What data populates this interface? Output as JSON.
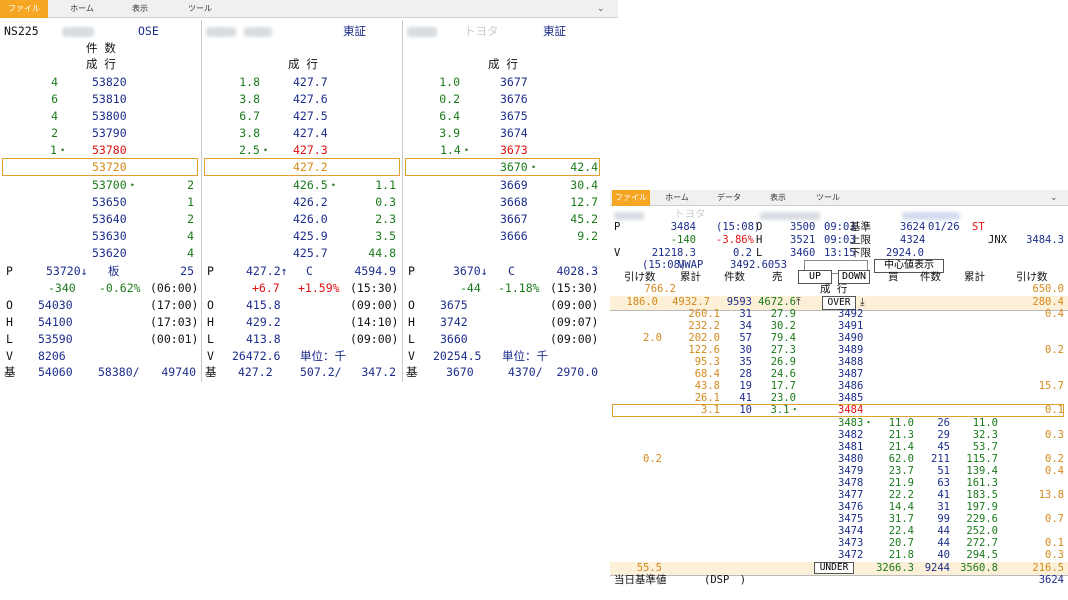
{
  "left_window": {
    "menu": [
      "ファイル",
      "ホーム",
      "表示",
      "ツール"
    ],
    "panel1": {
      "symbol": "NS225",
      "exchange": "OSE",
      "header1": "件 数",
      "header2": "成 行",
      "ask_rows": [
        {
          "qty": "4",
          "price": "53820"
        },
        {
          "qty": "6",
          "price": "53810"
        },
        {
          "qty": "4",
          "price": "53800"
        },
        {
          "qty": "2",
          "price": "53790"
        },
        {
          "qty": "1・",
          "price": "53780"
        }
      ],
      "current": {
        "price": "53720"
      },
      "bid_rows": [
        {
          "price": "53700・",
          "qty": "2"
        },
        {
          "price": "53650",
          "qty": "1"
        },
        {
          "price": "53640",
          "qty": "2"
        },
        {
          "price": "53630",
          "qty": "4"
        },
        {
          "price": "53620",
          "qty": "4"
        }
      ],
      "stats": {
        "p_label": "P",
        "p_value": "53720↓",
        "ita_label": "板",
        "ita_value": "25",
        "change": "-340",
        "change_pct": "-0.62%",
        "change_time": "(06:00)",
        "o_label": "O",
        "o_value": "54030",
        "o_time": "(17:00)",
        "h_label": "H",
        "h_value": "54100",
        "h_time": "(17:03)",
        "l_label": "L",
        "l_value": "53590",
        "l_time": "(00:01)",
        "v_label": "V",
        "v_value": "8206",
        "ki_label": "基",
        "ki_value": "54060",
        "ki_mid": "58380/",
        "ki_right": "49740"
      }
    },
    "panel2": {
      "exchange": "東証",
      "header2": "成 行",
      "ask_rows": [
        {
          "qty": "1.8",
          "price": "427.7"
        },
        {
          "qty": "3.8",
          "price": "427.6"
        },
        {
          "qty": "6.7",
          "price": "427.5"
        },
        {
          "qty": "3.8",
          "price": "427.4"
        },
        {
          "qty": "2.5・",
          "price": "427.3"
        }
      ],
      "current": {
        "price": "427.2"
      },
      "bid_rows": [
        {
          "price": "426.5・",
          "qty": "1.1"
        },
        {
          "price": "426.2",
          "qty": "0.3"
        },
        {
          "price": "426.0",
          "qty": "2.3"
        },
        {
          "price": "425.9",
          "qty": "3.5"
        },
        {
          "price": "425.7",
          "qty": "44.8"
        }
      ],
      "stats": {
        "p_label": "P",
        "p_value": "427.2↑",
        "c_label": "C",
        "c_value": "4594.9",
        "change": "+6.7",
        "change_pct": "+1.59%",
        "change_time": "(15:30)",
        "o_label": "O",
        "o_value": "415.8",
        "o_time": "(09:00)",
        "h_label": "H",
        "h_value": "429.2",
        "h_time": "(14:10)",
        "l_label": "L",
        "l_value": "413.8",
        "l_time": "(09:00)",
        "v_label": "V",
        "v_value": "26472.6",
        "unit": "単位：千",
        "ki_label": "基",
        "ki_value": "427.2",
        "ki_mid": "507.2/",
        "ki_right": "347.2"
      }
    },
    "panel3": {
      "name": "トヨタ",
      "exchange": "東証",
      "header2": "成 行",
      "ask_rows": [
        {
          "qty": "1.0",
          "price": "3677"
        },
        {
          "qty": "0.2",
          "price": "3676"
        },
        {
          "qty": "6.4",
          "price": "3675"
        },
        {
          "qty": "3.9",
          "price": "3674"
        },
        {
          "qty": "1.4・",
          "price": "3673"
        }
      ],
      "bid_rows": [
        {
          "price": "3670・",
          "qty": "42.4"
        },
        {
          "price": "3669",
          "qty": "30.4"
        },
        {
          "price": "3668",
          "qty": "12.7"
        },
        {
          "price": "3667",
          "qty": "45.2"
        },
        {
          "price": "3666",
          "qty": "9.2"
        }
      ],
      "stats": {
        "p_label": "P",
        "p_value": "3670↓",
        "c_label": "C",
        "c_value": "4028.3",
        "change": "-44",
        "change_pct": "-1.18%",
        "change_time": "(15:30)",
        "o_label": "O",
        "o_value": "3675",
        "o_time": "(09:00)",
        "h_label": "H",
        "h_value": "3742",
        "h_time": "(09:07)",
        "l_label": "L",
        "l_value": "3660",
        "l_time": "(09:00)",
        "v_label": "V",
        "v_value": "20254.5",
        "unit": "単位：千",
        "ki_label": "基",
        "ki_value": "3670",
        "ki_mid": "4370/",
        "ki_right": "2970.0"
      }
    }
  },
  "right_window": {
    "menu": [
      "ファイル",
      "ホーム",
      "データ",
      "表示",
      "ツール"
    ],
    "name": "トヨタ",
    "header": {
      "p_label": "P",
      "p_value": "3484",
      "p_time": "(15:08)",
      "o_label": "O",
      "o_value": "3500",
      "o_time": "09:03",
      "kijun_label": "基準",
      "kijun_value": "3624",
      "kijun_date": "01/26",
      "st": "ST",
      "change": "-140",
      "change_pct": "-3.86%",
      "h_label": "H",
      "h_value": "3521",
      "h_time": "09:03",
      "upper_label": "上限",
      "upper_value": "4324",
      "jnx_label": "JNX",
      "jnx_value": "3484.3",
      "v_label": "V",
      "v_value": "21218.3",
      "l_num": "0.2",
      "l_label": "L",
      "l_value": "3460",
      "l_time": "13:15",
      "lower_label": "下限",
      "lower_value": "2924.0",
      "vwap_time": "(15:08)",
      "vwap_label": "VWAP",
      "vwap_value": "3492.6053",
      "center_btn": "中心値表示"
    },
    "columns": {
      "hikesu_left": "引け数",
      "ruikei_left": "累計",
      "kensu_left": "件数",
      "uri": "売",
      "up_btn": "UP",
      "down_btn": "DOWN",
      "kai": "買",
      "kensu_right": "件数",
      "ruikei_right": "累計",
      "hikesu_right": "引け数"
    },
    "market_row": {
      "hikesu_left": "766.2",
      "label": "成 行",
      "hikesu_right": "650.0"
    },
    "over_row": {
      "hikesu_left": "186.0",
      "ruikei": "4932.7",
      "kensu": "9593",
      "uri": "4672.6",
      "label": "OVER",
      "hikesu_right": "280.4"
    },
    "ask_rows": [
      {
        "hikesu": "",
        "ruikei": "260.1",
        "kensu": "31",
        "uri": "27.9",
        "price": "3492",
        "hikesu_r": "0.4"
      },
      {
        "hikesu": "",
        "ruikei": "232.2",
        "kensu": "34",
        "uri": "30.2",
        "price": "3491",
        "hikesu_r": ""
      },
      {
        "hikesu": "2.0",
        "ruikei": "202.0",
        "kensu": "57",
        "uri": "79.4",
        "price": "3490",
        "hikesu_r": ""
      },
      {
        "hikesu": "",
        "ruikei": "122.6",
        "kensu": "30",
        "uri": "27.3",
        "price": "3489",
        "hikesu_r": "0.2"
      },
      {
        "hikesu": "",
        "ruikei": "95.3",
        "kensu": "35",
        "uri": "26.9",
        "price": "3488",
        "hikesu_r": ""
      },
      {
        "hikesu": "",
        "ruikei": "68.4",
        "kensu": "28",
        "uri": "24.6",
        "price": "3487",
        "hikesu_r": ""
      },
      {
        "hikesu": "",
        "ruikei": "43.8",
        "kensu": "19",
        "uri": "17.7",
        "price": "3486",
        "hikesu_r": "15.7"
      },
      {
        "hikesu": "",
        "ruikei": "26.1",
        "kensu": "41",
        "uri": "23.0",
        "price": "3485",
        "hikesu_r": ""
      },
      {
        "hikesu": "",
        "ruikei": "3.1",
        "kensu": "10",
        "uri": "3.1・",
        "price": "3484",
        "hikesu_r": "0.1"
      }
    ],
    "bid_rows": [
      {
        "hikesu": "",
        "price": "3483・",
        "kai": "11.0",
        "kensu": "26",
        "ruikei": "11.0",
        "hikesu_r": ""
      },
      {
        "hikesu": "",
        "price": "3482",
        "kai": "21.3",
        "kensu": "29",
        "ruikei": "32.3",
        "hikesu_r": "0.3"
      },
      {
        "hikesu": "",
        "price": "3481",
        "kai": "21.4",
        "kensu": "45",
        "ruikei": "53.7",
        "hikesu_r": ""
      },
      {
        "hikesu": "0.2",
        "price": "3480",
        "kai": "62.0",
        "kensu": "211",
        "ruikei": "115.7",
        "hikesu_r": "0.2"
      },
      {
        "hikesu": "",
        "price": "3479",
        "kai": "23.7",
        "kensu": "51",
        "ruikei": "139.4",
        "hikesu_r": "0.4"
      },
      {
        "hikesu": "",
        "price": "3478",
        "kai": "21.9",
        "kensu": "63",
        "ruikei": "161.3",
        "hikesu_r": ""
      },
      {
        "hikesu": "",
        "price": "3477",
        "kai": "22.2",
        "kensu": "41",
        "ruikei": "183.5",
        "hikesu_r": "13.8"
      },
      {
        "hikesu": "",
        "price": "3476",
        "kai": "14.4",
        "kensu": "31",
        "ruikei": "197.9",
        "hikesu_r": ""
      },
      {
        "hikesu": "",
        "price": "3475",
        "kai": "31.7",
        "kensu": "99",
        "ruikei": "229.6",
        "hikesu_r": "0.7"
      },
      {
        "hikesu": "",
        "price": "3474",
        "kai": "22.4",
        "kensu": "44",
        "ruikei": "252.0",
        "hikesu_r": ""
      },
      {
        "hikesu": "",
        "price": "3473",
        "kai": "20.7",
        "kensu": "44",
        "ruikei": "272.7",
        "hikesu_r": "0.1"
      },
      {
        "hikesu": "",
        "price": "3472",
        "kai": "21.8",
        "kensu": "40",
        "ruikei": "294.5",
        "hikesu_r": "0.3"
      }
    ],
    "under_row": {
      "hikesu_left": "55.5",
      "label": "UNDER",
      "kai": "3266.3",
      "kensu": "9244",
      "ruikei": "3560.8",
      "hikesu_right": "216.5"
    },
    "footer": {
      "label": "当日基準値",
      "dsp": "(DSP　)",
      "value": "3624"
    }
  }
}
